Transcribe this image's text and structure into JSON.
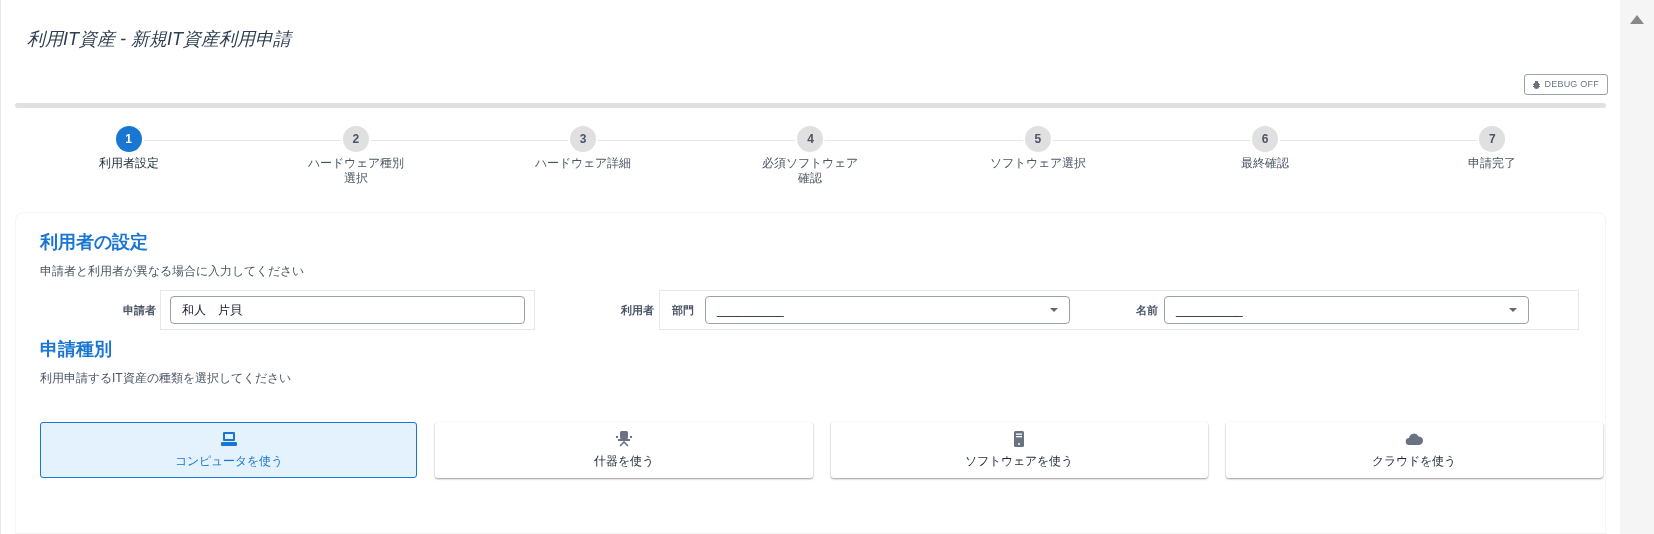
{
  "page_title": "利用IT資産 - 新規IT資産利用申請",
  "debug_button": {
    "label": "DEBUG OFF",
    "on": false
  },
  "steps": [
    {
      "number": "1",
      "label": "利用者設定",
      "selected": true
    },
    {
      "number": "2",
      "label": "ハードウェア種別選択",
      "selected": false
    },
    {
      "number": "3",
      "label": "ハードウェア詳細",
      "selected": false
    },
    {
      "number": "4",
      "label": "必須ソフトウェア確認",
      "selected": false
    },
    {
      "number": "5",
      "label": "ソフトウェア選択",
      "selected": false
    },
    {
      "number": "6",
      "label": "最終確認",
      "selected": false
    },
    {
      "number": "7",
      "label": "申請完了",
      "selected": false
    }
  ],
  "user_section": {
    "heading": "利用者の設定",
    "description": "申請者と利用者が異なる場合に入力してください",
    "applicant": {
      "label": "申請者",
      "value": "和人　片貝"
    },
    "user": {
      "label": "利用者",
      "department": {
        "label": "部門",
        "value": "__________"
      },
      "name": {
        "label": "名前",
        "value": "__________"
      }
    }
  },
  "type_section": {
    "heading": "申請種別",
    "description": "利用申請するIT資産の種類を選択してください",
    "options": [
      {
        "kind": "computer",
        "label": "コンピュータを使う",
        "selected": true
      },
      {
        "kind": "furniture",
        "label": "什器を使う",
        "selected": false
      },
      {
        "kind": "software",
        "label": "ソフトウェアを使う",
        "selected": false
      },
      {
        "kind": "cloud",
        "label": "クラウドを使う",
        "selected": false
      }
    ]
  }
}
